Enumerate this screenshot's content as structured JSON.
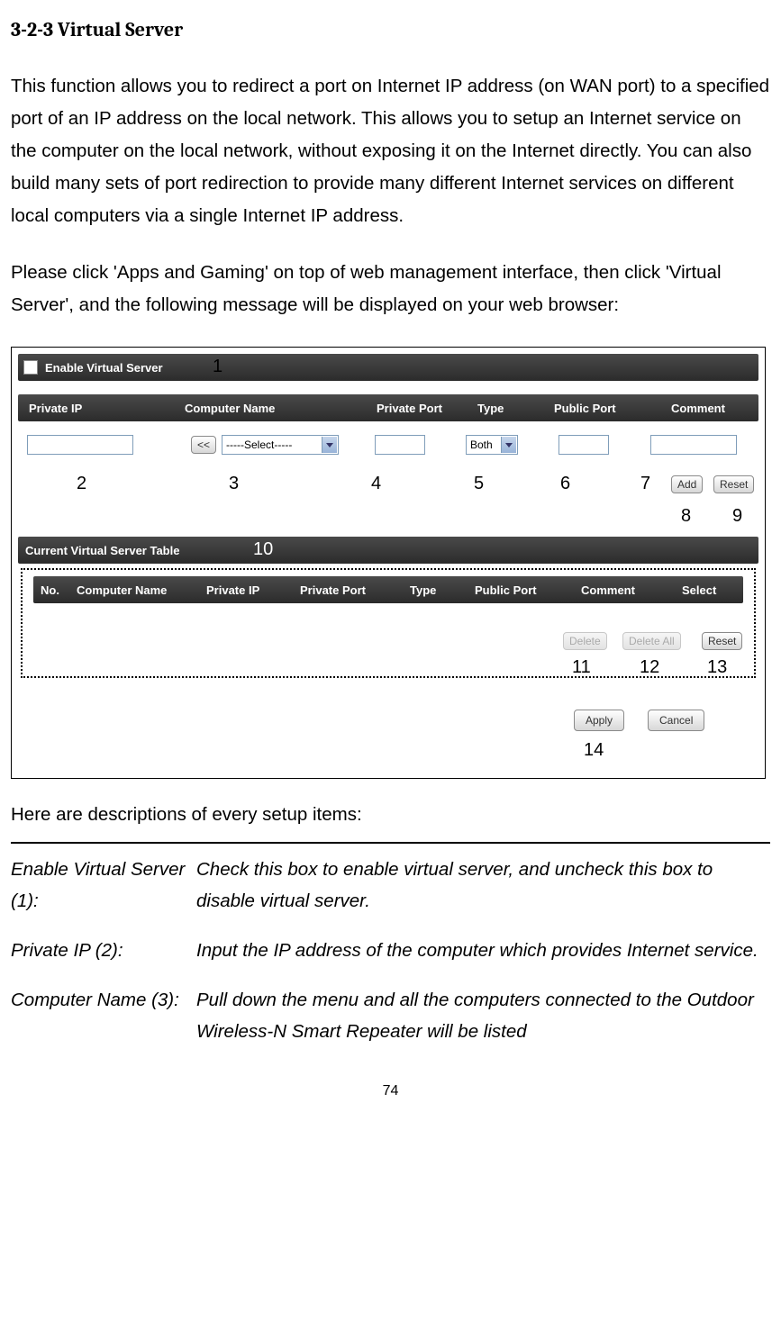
{
  "section_title": "3-2-3 Virtual Server",
  "para1": "This function allows you to redirect a port on Internet IP address (on WAN port) to a specified port of an IP address on the local network. This allows you to setup an Internet service on the computer on the local network, without exposing it on the Internet directly. You can also build many sets of port redirection to provide many different Internet services on different local computers via a single Internet IP address.",
  "para2": "Please click 'Apps and Gaming' on top of web management interface, then click 'Virtual Server', and the following message will be displayed on your web browser:",
  "ui": {
    "enable_label": "Enable Virtual Server",
    "headers_top": {
      "private_ip": "Private IP",
      "computer_name": "Computer Name",
      "private_port": "Private Port",
      "type": "Type",
      "public_port": "Public Port",
      "comment": "Comment"
    },
    "btn_assign": "<<",
    "select_placeholder": "-----Select-----",
    "type_value": "Both",
    "btn_add": "Add",
    "btn_reset": "Reset",
    "current_table_label": "Current Virtual Server Table",
    "headers_bottom": {
      "no": "No.",
      "computer_name": "Computer Name",
      "private_ip": "Private IP",
      "private_port": "Private Port",
      "type": "Type",
      "public_port": "Public Port",
      "comment": "Comment",
      "select": "Select"
    },
    "btn_delete": "Delete",
    "btn_delete_all": "Delete All",
    "btn_reset2": "Reset",
    "btn_apply": "Apply",
    "btn_cancel": "Cancel"
  },
  "annotations": {
    "a1": "1",
    "a2": "2",
    "a3": "3",
    "a4": "4",
    "a5": "5",
    "a6": "6",
    "a7": "7",
    "a8": "8",
    "a9": "9",
    "a10": "10",
    "a11": "11",
    "a12": "12",
    "a13": "13",
    "a14": "14"
  },
  "desc_intro": "Here are descriptions of every setup items:",
  "desc": {
    "k1": "Enable Virtual Server (1):",
    "v1": "Check this box to enable virtual server, and uncheck this box to disable virtual server.",
    "k2": "Private IP (2):",
    "v2": "Input the IP address of the computer which provides Internet service.",
    "k3": "Computer Name (3):",
    "v3": "Pull down the menu and all the computers connected to the Outdoor Wireless-N Smart Repeater will be listed"
  },
  "page_number": "74"
}
